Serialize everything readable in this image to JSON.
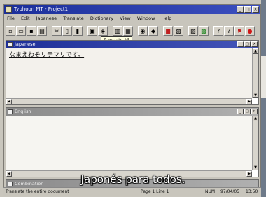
{
  "window": {
    "title": "Typhoon MT - Project1"
  },
  "menu": [
    "File",
    "Edit",
    "Japanese",
    "Translate",
    "Dictionary",
    "View",
    "Window",
    "Help"
  ],
  "toolbar": {
    "tooltip": "Translate All"
  },
  "panes": {
    "japanese": {
      "title": "Japanese",
      "text": "なまえわそリテマリです。"
    },
    "english": {
      "title": "English",
      "text": ""
    },
    "bottom": {
      "title": "Combination"
    }
  },
  "status": {
    "message": "Translate the entire document",
    "position": "Page 1 Line 1",
    "mode": "NUM",
    "date": "97/04/05",
    "time": "13:50"
  },
  "subtitle": "Japonés para todos.",
  "colors": {
    "title_bar": "#1b2f9a",
    "background": "#c8c5bc"
  }
}
